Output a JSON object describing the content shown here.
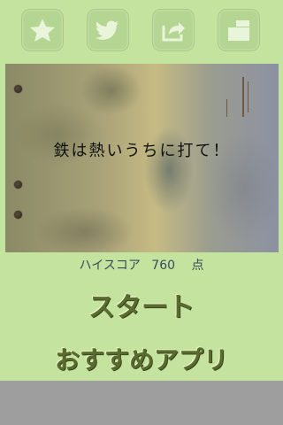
{
  "toolbar": {
    "buttons": [
      {
        "icon": "star-icon"
      },
      {
        "icon": "twitter-bird-icon"
      },
      {
        "icon": "share-arrow-icon"
      },
      {
        "icon": "window-icon"
      }
    ]
  },
  "board": {
    "proverb": "鉄は熱いうちに打て！"
  },
  "score": {
    "label": "ハイスコア",
    "value": "760",
    "unit": "点"
  },
  "menu": {
    "start": "スタート",
    "recommend": "おすすめアプリ"
  },
  "colors": {
    "background": "#c4e39e",
    "button_text": "#5a6b2e",
    "bottom_bar": "#9e9e9e"
  }
}
